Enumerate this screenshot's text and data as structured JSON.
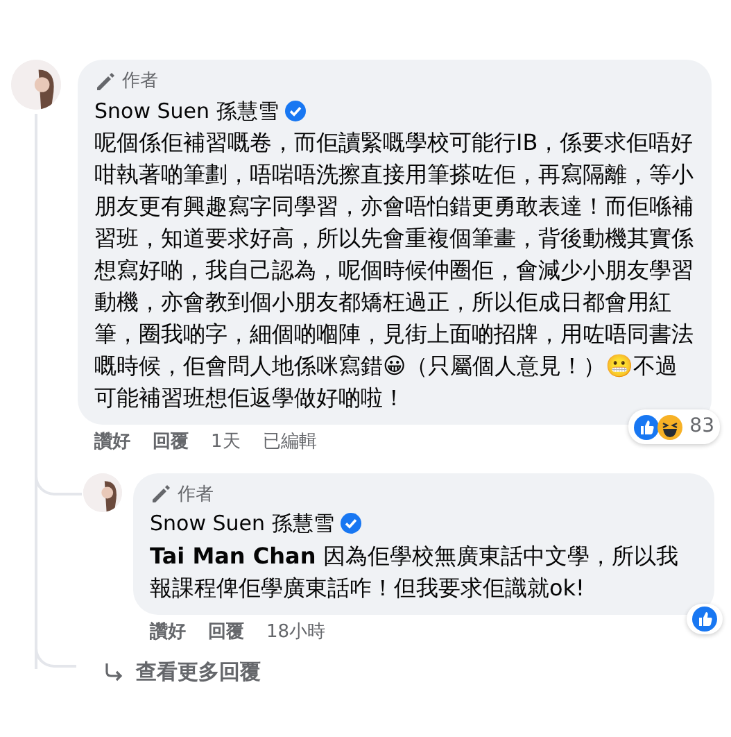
{
  "comment": {
    "author_badge": "作者",
    "author": "Snow Suen 孫慧雪",
    "verified": true,
    "text": "呢個係佢補習嘅卷，而佢讀緊嘅學校可能行IB，係要求佢唔好咁執著啲筆劃，唔啱唔洗擦直接用筆搽咗佢，再寫隔離，等小朋友更有興趣寫字同學習，亦會唔怕錯更勇敢表達！而佢喺補習班，知道要求好高，所以先會重複個筆畫，背後動機其實係想寫好啲，我自己認為，呢個時候仲圈佢，會減少小朋友學習動機，亦會教到個小朋友都矯枉過正，所以佢成日都會用紅筆，圈我啲字，細個啲嗰陣，見街上面啲招牌，用咗唔同書法嘅時候，佢會問人地係咪寫錯😀（只屬個人意見！）😬不過可能補習班想佢返學做好啲啦！",
    "reactions": {
      "icons": [
        {
          "kind": "like"
        },
        {
          "kind": "haha"
        }
      ],
      "count": "83"
    },
    "actions": [
      {
        "kind": "link",
        "label": "讚好"
      },
      {
        "kind": "link",
        "label": "回覆"
      },
      {
        "kind": "time",
        "label": "1天"
      },
      {
        "kind": "note",
        "label": "已編輯"
      }
    ],
    "replies": [
      {
        "author_badge": "作者",
        "author": "Snow Suen 孫慧雪",
        "verified": true,
        "text": "**Tai Man Chan** 因為佢學校無廣東話中文學，所以我報課程俾佢學廣東話咋！但我要求佢識就ok!",
        "reactions": {
          "icons": [
            {
              "kind": "like"
            }
          ]
        },
        "actions": [
          {
            "kind": "link",
            "label": "讚好"
          },
          {
            "kind": "link",
            "label": "回覆"
          },
          {
            "kind": "time",
            "label": "18小時"
          }
        ]
      }
    ],
    "more_replies": "查看更多回覆"
  }
}
